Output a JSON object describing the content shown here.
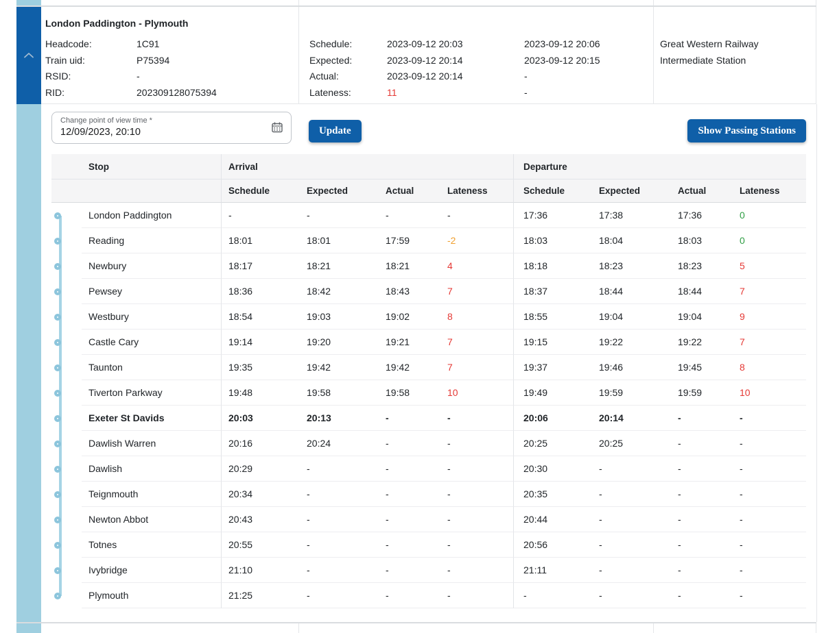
{
  "train_card": {
    "title": "London Paddington - Plymouth",
    "details": [
      {
        "label": "Headcode:",
        "value": "1C91"
      },
      {
        "label": "Train uid:",
        "value": "P75394"
      },
      {
        "label": "RSID:",
        "value": "-"
      },
      {
        "label": "RID:",
        "value": "202309128075394"
      }
    ],
    "timing": [
      {
        "label": "Schedule:",
        "arrival": "2023-09-12 20:03",
        "departure": "2023-09-12 20:06"
      },
      {
        "label": "Expected:",
        "arrival": "2023-09-12 20:14",
        "departure": "2023-09-12 20:15"
      },
      {
        "label": "Actual:",
        "arrival": "2023-09-12 20:14",
        "departure": "-"
      },
      {
        "label": "Lateness:",
        "arrival": "11",
        "departure": "-"
      }
    ],
    "operator": "Great Western Railway",
    "station_type": "Intermediate Station"
  },
  "controls": {
    "datetime_label": "Change point of view time *",
    "datetime_value": "12/09/2023, 20:10",
    "update_button": "Update",
    "show_passing_button": "Show Passing Stations"
  },
  "stops_table": {
    "group_headers": {
      "stop": "Stop",
      "arrival": "Arrival",
      "departure": "Departure"
    },
    "sub_headers": {
      "arr_schedule": "Schedule",
      "arr_expected": "Expected",
      "arr_actual": "Actual",
      "arr_lateness": "Lateness",
      "dep_schedule": "Schedule",
      "dep_expected": "Expected",
      "dep_actual": "Actual",
      "dep_lateness": "Lateness"
    },
    "rows": [
      {
        "stop": "London Paddington",
        "arrival": [
          "-",
          "-",
          "-",
          "-"
        ],
        "departure": [
          "17:36",
          "17:38",
          "17:36",
          "0"
        ]
      },
      {
        "stop": "Reading",
        "arrival": [
          "18:01",
          "18:01",
          "17:59",
          "-2"
        ],
        "departure": [
          "18:03",
          "18:04",
          "18:03",
          "0"
        ]
      },
      {
        "stop": "Newbury",
        "arrival": [
          "18:17",
          "18:21",
          "18:21",
          "4"
        ],
        "departure": [
          "18:18",
          "18:23",
          "18:23",
          "5"
        ]
      },
      {
        "stop": "Pewsey",
        "arrival": [
          "18:36",
          "18:42",
          "18:43",
          "7"
        ],
        "departure": [
          "18:37",
          "18:44",
          "18:44",
          "7"
        ]
      },
      {
        "stop": "Westbury",
        "arrival": [
          "18:54",
          "19:03",
          "19:02",
          "8"
        ],
        "departure": [
          "18:55",
          "19:04",
          "19:04",
          "9"
        ]
      },
      {
        "stop": "Castle Cary",
        "arrival": [
          "19:14",
          "19:20",
          "19:21",
          "7"
        ],
        "departure": [
          "19:15",
          "19:22",
          "19:22",
          "7"
        ]
      },
      {
        "stop": "Taunton",
        "arrival": [
          "19:35",
          "19:42",
          "19:42",
          "7"
        ],
        "departure": [
          "19:37",
          "19:46",
          "19:45",
          "8"
        ]
      },
      {
        "stop": "Tiverton Parkway",
        "arrival": [
          "19:48",
          "19:58",
          "19:58",
          "10"
        ],
        "departure": [
          "19:49",
          "19:59",
          "19:59",
          "10"
        ]
      },
      {
        "stop": "Exeter St Davids",
        "bold": true,
        "arrival": [
          "20:03",
          "20:13",
          "-",
          "-"
        ],
        "departure": [
          "20:06",
          "20:14",
          "-",
          "-"
        ]
      },
      {
        "stop": "Dawlish Warren",
        "arrival": [
          "20:16",
          "20:24",
          "-",
          "-"
        ],
        "departure": [
          "20:25",
          "20:25",
          "-",
          "-"
        ]
      },
      {
        "stop": "Dawlish",
        "arrival": [
          "20:29",
          "-",
          "-",
          "-"
        ],
        "departure": [
          "20:30",
          "-",
          "-",
          "-"
        ]
      },
      {
        "stop": "Teignmouth",
        "arrival": [
          "20:34",
          "-",
          "-",
          "-"
        ],
        "departure": [
          "20:35",
          "-",
          "-",
          "-"
        ]
      },
      {
        "stop": "Newton Abbot",
        "arrival": [
          "20:43",
          "-",
          "-",
          "-"
        ],
        "departure": [
          "20:44",
          "-",
          "-",
          "-"
        ]
      },
      {
        "stop": "Totnes",
        "arrival": [
          "20:55",
          "-",
          "-",
          "-"
        ],
        "departure": [
          "20:56",
          "-",
          "-",
          "-"
        ]
      },
      {
        "stop": "Ivybridge",
        "arrival": [
          "21:10",
          "-",
          "-",
          "-"
        ],
        "departure": [
          "21:11",
          "-",
          "-",
          "-"
        ]
      },
      {
        "stop": "Plymouth",
        "arrival": [
          "21:25",
          "-",
          "-",
          "-"
        ],
        "departure": [
          "-",
          "-",
          "-",
          "-"
        ]
      }
    ]
  },
  "colors": {
    "primary_blue": "#0f5fa8",
    "rail_light_blue": "#9fcfe0",
    "timeline_blue": "#8cc5dc",
    "lateness_late": "#e53935",
    "lateness_early": "#f0a030",
    "lateness_on_time": "#2f9e44"
  }
}
